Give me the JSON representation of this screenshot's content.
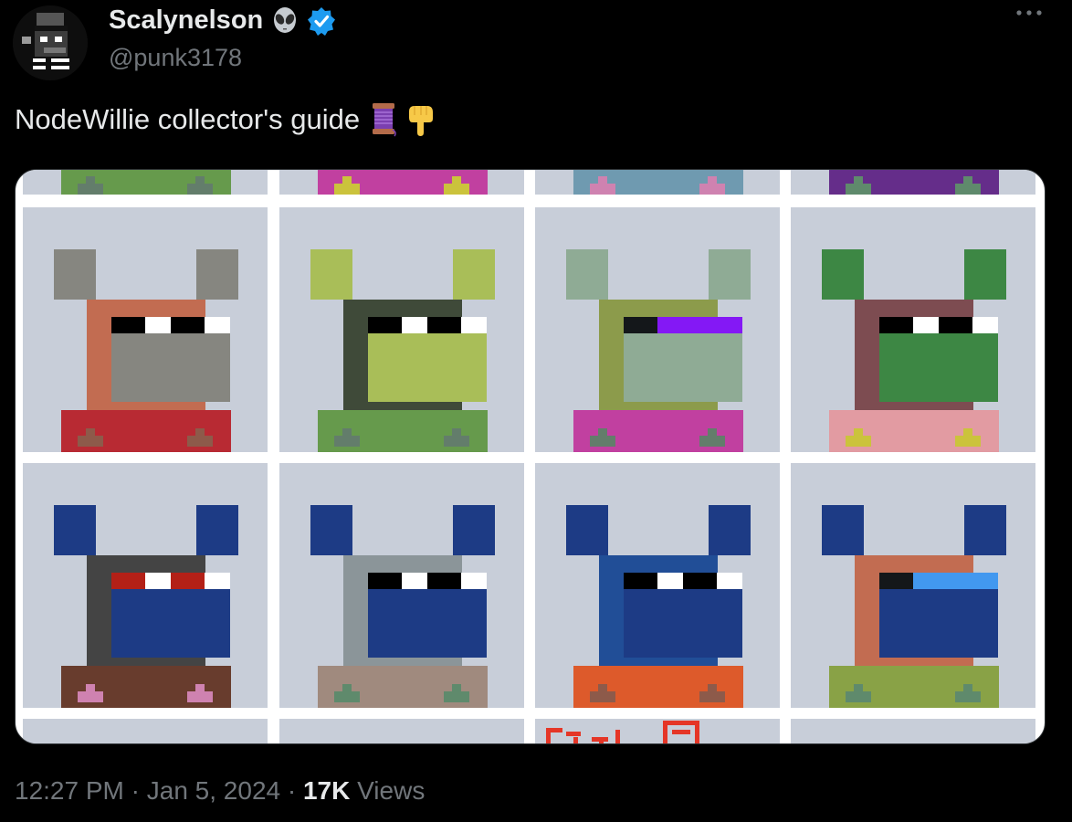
{
  "author": {
    "display_name": "Scalynelson",
    "handle": "@punk3178",
    "emoji_icon": "alien-emoji-icon",
    "badge_icon": "verified-badge-icon",
    "badge_color": "#1d9bf0"
  },
  "menu_icon": "more-icon",
  "tweet": {
    "text": "NodeWillie collector's guide",
    "emoji_icons": [
      "thread-emoji-icon",
      "pointing-down-emoji-icon"
    ]
  },
  "media": {
    "background": "#ffffff",
    "tile_background": "#c8ced9",
    "partial_top_row": [
      {
        "body": "#669a4c",
        "buttons": "#637d6b"
      },
      {
        "body": "#c140a0",
        "buttons": "#cbc33c"
      },
      {
        "body": "#6f9ab0",
        "buttons": "#cf82b0"
      },
      {
        "body": "#652d8a",
        "buttons": "#5f8a6c"
      }
    ],
    "characters": [
      {
        "ears": "#868680",
        "head": "#c26c51",
        "face": "#868680",
        "eyes": "white-black",
        "visor": null,
        "body": "#b82a33",
        "buttons": "#8d5a4a"
      },
      {
        "ears": "#a9be58",
        "head": "#3f4a39",
        "face": "#a9be58",
        "eyes": "white-black",
        "visor": null,
        "body": "#669a4c",
        "buttons": "#637d6b"
      },
      {
        "ears": "#8fab95",
        "head": "#8c9b4b",
        "face": "#8fab95",
        "eyes": "visor",
        "visor": "#8418f5",
        "body": "#c140a0",
        "buttons": "#637d6b"
      },
      {
        "ears": "#3d8744",
        "head": "#7d4c51",
        "face": "#3d8744",
        "eyes": "white-black",
        "visor": null,
        "body": "#e29ba2",
        "buttons": "#cbc33c"
      },
      {
        "ears": "#1d3b85",
        "head": "#444444",
        "face": "#1d3b85",
        "eyes": "white-red",
        "visor": null,
        "body": "#683c2d",
        "buttons": "#cf82b0"
      },
      {
        "ears": "#1d3b85",
        "head": "#8b9599",
        "face": "#1d3b85",
        "eyes": "white-black",
        "visor": null,
        "body": "#a08a7e",
        "buttons": "#5f8a6c"
      },
      {
        "ears": "#1d3b85",
        "head": "#214e97",
        "face": "#1d3b85",
        "eyes": "white-black",
        "visor": null,
        "body": "#dd5a2b",
        "buttons": "#8d5a4a"
      },
      {
        "ears": "#1d3b85",
        "head": "#c26c51",
        "face": "#1d3b85",
        "eyes": "visor",
        "visor": "#4298ef",
        "body": "#89a246",
        "buttons": "#5f8a6c"
      }
    ],
    "accent_red": "#e53627"
  },
  "footer": {
    "time": "12:27 PM",
    "separator": "·",
    "date": "Jan 5, 2024",
    "views_count": "17K",
    "views_label": "Views"
  }
}
